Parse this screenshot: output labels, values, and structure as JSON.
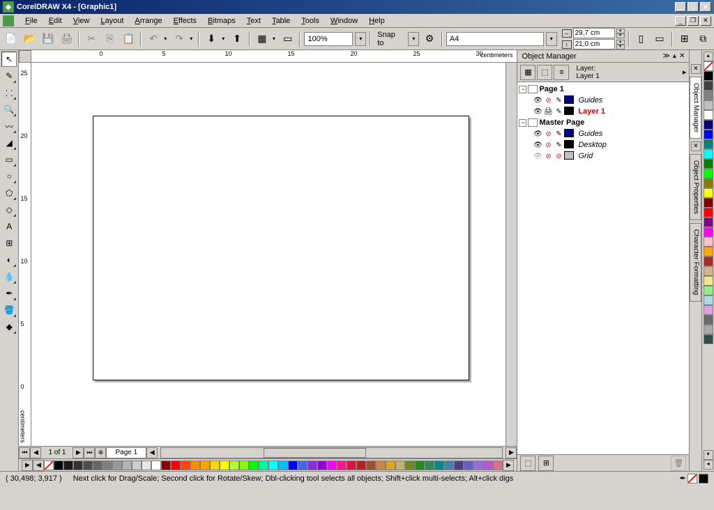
{
  "titlebar": {
    "title": "CorelDRAW X4 - [Graphic1]"
  },
  "menubar": {
    "items": [
      "File",
      "Edit",
      "View",
      "Layout",
      "Arrange",
      "Effects",
      "Bitmaps",
      "Text",
      "Table",
      "Tools",
      "Window",
      "Help"
    ]
  },
  "toolbar": {
    "zoom": "100%",
    "snap_label": "Snap to",
    "paper_size": "A4",
    "width": "29,7 cm",
    "height": "21,0 cm"
  },
  "ruler": {
    "units": "centimeters",
    "h_ticks": [
      "0",
      "5",
      "10",
      "15",
      "20",
      "25",
      "30"
    ],
    "v_ticks": [
      "25",
      "20",
      "15",
      "10",
      "5",
      "0"
    ]
  },
  "docker": {
    "title": "Object Manager",
    "layer_label": "Layer:",
    "layer_name": "Layer 1",
    "page1": "Page 1",
    "guides": "Guides",
    "layer1": "Layer 1",
    "master_page": "Master Page",
    "guides2": "Guides",
    "desktop": "Desktop",
    "grid": "Grid"
  },
  "docker_tabs": [
    "Object Manager",
    "Object Properties",
    "Character Formatting"
  ],
  "page_nav": {
    "counter": "1 of 1",
    "tab": "Page 1"
  },
  "statusbar": {
    "coords": "( 30,498; 3,917 )",
    "hint": "Next click for Drag/Scale; Second click for Rotate/Skew; Dbl-clicking tool selects all objects; Shift+click multi-selects; Alt+click digs"
  },
  "palette_colors": [
    "#000000",
    "#404040",
    "#808080",
    "#c0c0c0",
    "#ffffff",
    "#000080",
    "#0000ff",
    "#008080",
    "#00ffff",
    "#008000",
    "#00ff00",
    "#808000",
    "#ffff00",
    "#800000",
    "#ff0000",
    "#800080",
    "#ff00ff",
    "#ffc0cb",
    "#ffa500",
    "#a52a2a",
    "#d2b48c",
    "#f0e68c",
    "#90ee90",
    "#add8e6",
    "#dda0dd",
    "#696969",
    "#a9a9a9",
    "#2f4f4f"
  ],
  "strip_colors": [
    "#000000",
    "#1a1a1a",
    "#333333",
    "#4d4d4d",
    "#666666",
    "#808080",
    "#999999",
    "#b3b3b3",
    "#cccccc",
    "#e6e6e6",
    "#ffffff",
    "#8b0000",
    "#ff0000",
    "#ff4500",
    "#ff8c00",
    "#ffa500",
    "#ffd700",
    "#ffff00",
    "#adff2f",
    "#7fff00",
    "#00ff00",
    "#00fa9a",
    "#00ffff",
    "#00bfff",
    "#0000ff",
    "#4169e1",
    "#8a2be2",
    "#9400d3",
    "#ff00ff",
    "#ff1493",
    "#dc143c",
    "#b22222",
    "#a0522d",
    "#cd853f",
    "#daa520",
    "#bdb76b",
    "#6b8e23",
    "#228b22",
    "#2e8b57",
    "#008b8b",
    "#4682b4",
    "#483d8b",
    "#6a5acd",
    "#9370db",
    "#ba55d3",
    "#db7093"
  ]
}
